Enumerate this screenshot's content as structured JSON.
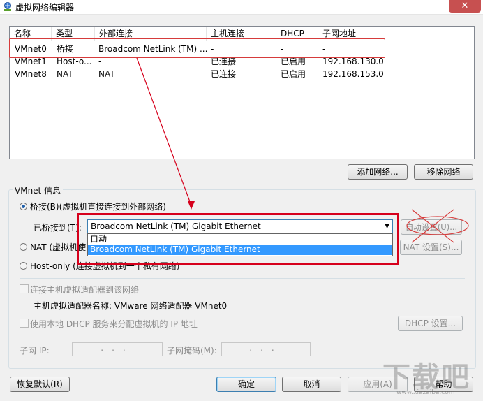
{
  "window": {
    "title": "虚拟网络编辑器",
    "close_glyph": "✕"
  },
  "list": {
    "columns": [
      "名称",
      "类型",
      "外部连接",
      "主机连接",
      "DHCP",
      "子网地址"
    ],
    "rows": [
      [
        "VMnet0",
        "桥接",
        "Broadcom NetLink (TM) ...",
        "-",
        "-",
        "-"
      ],
      [
        "VMnet1",
        "Host-o...",
        "-",
        "已连接",
        "已启用",
        "192.168.130.0"
      ],
      [
        "VMnet8",
        "NAT",
        "NAT",
        "已连接",
        "已启用",
        "192.168.153.0"
      ]
    ]
  },
  "buttons": {
    "add_network": "添加网络...",
    "remove_network": "移除网络",
    "auto_settings": "自动设置(U)...",
    "nat_settings": "NAT 设置(S)...",
    "dhcp_settings": "DHCP 设置...",
    "restore": "恢复默认(R)",
    "ok": "确定",
    "cancel": "取消",
    "apply": "应用(A)",
    "help": "帮助"
  },
  "vmnet_info": {
    "group_title": "VMnet 信息",
    "bridged": "桥接(B)(虚拟机直接连接到外部网络)",
    "bridged_to_label": "已桥接到(T):",
    "bridged_to_value": "Broadcom NetLink (TM) Gigabit Ethernet",
    "dropdown_options": [
      "自动",
      "Broadcom NetLink (TM) Gigabit Ethernet"
    ],
    "nat": "NAT (虚拟机使",
    "host_only": "Host-only (连接虚拟机到一个私有网络)",
    "connect_adapter": "连接主机虚拟适配器到该网络",
    "adapter_name": "主机虚拟适配器名称: VMware 网络适配器 VMnet0",
    "use_dhcp": "使用本地 DHCP 服务来分配虚拟机的 IP 地址",
    "subnet_ip_label": "子网 IP:",
    "subnet_mask_label": "子网掩码(M):",
    "ip_dots": "..."
  },
  "watermark": {
    "text": "下载吧",
    "url": "www.xiazaiba.com"
  },
  "colors": {
    "highlight_red": "#d6001c",
    "selection_blue": "#3399ff",
    "close_red": "#c75050"
  }
}
